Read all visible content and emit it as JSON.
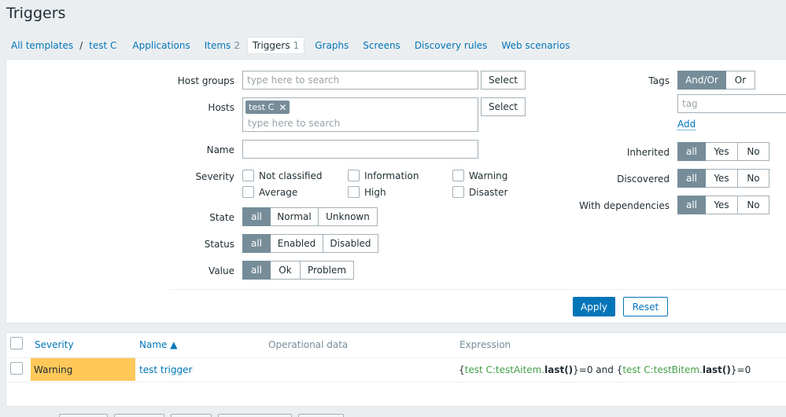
{
  "page": {
    "title": "Triggers"
  },
  "nav": {
    "breadcrumb": [
      "All templates",
      "test C"
    ],
    "tabs": [
      {
        "label": "Applications",
        "count": ""
      },
      {
        "label": "Items",
        "count": "2"
      },
      {
        "label": "Triggers",
        "count": "1",
        "active": true
      },
      {
        "label": "Graphs",
        "count": ""
      },
      {
        "label": "Screens",
        "count": ""
      },
      {
        "label": "Discovery rules",
        "count": ""
      },
      {
        "label": "Web scenarios",
        "count": ""
      }
    ]
  },
  "filter": {
    "host_groups_label": "Host groups",
    "host_groups_placeholder": "type here to search",
    "select_label": "Select",
    "hosts_label": "Hosts",
    "hosts_chip": "test C",
    "hosts_placeholder": "type here to search",
    "name_label": "Name",
    "severity_label": "Severity",
    "severities": [
      "Not classified",
      "Information",
      "Warning",
      "Average",
      "High",
      "Disaster"
    ],
    "state_label": "State",
    "state_options": [
      "all",
      "Normal",
      "Unknown"
    ],
    "status_label": "Status",
    "status_options": [
      "all",
      "Enabled",
      "Disabled"
    ],
    "value_label": "Value",
    "value_options": [
      "all",
      "Ok",
      "Problem"
    ],
    "tags_label": "Tags",
    "tags_options": [
      "And/Or",
      "Or"
    ],
    "tag_placeholder": "tag",
    "add_label": "Add",
    "inherited_label": "Inherited",
    "discovered_label": "Discovered",
    "with_dependencies_label": "With dependencies",
    "yes_no_options": [
      "all",
      "Yes",
      "No"
    ],
    "apply_label": "Apply",
    "reset_label": "Reset"
  },
  "table": {
    "columns": [
      "Severity",
      "Name ▲",
      "Operational data",
      "Expression"
    ],
    "rows": [
      {
        "severity": "Warning",
        "severity_color": "#ffc859",
        "name": "test trigger",
        "operational_data": "",
        "expression": {
          "open1": "{",
          "item1": "test C:testAitem.",
          "func1": "last()",
          "close1": "}=0 and ",
          "open2": "{",
          "item2": "test C:testBitem.",
          "func2": "last()",
          "close2": "}=0"
        }
      }
    ]
  }
}
